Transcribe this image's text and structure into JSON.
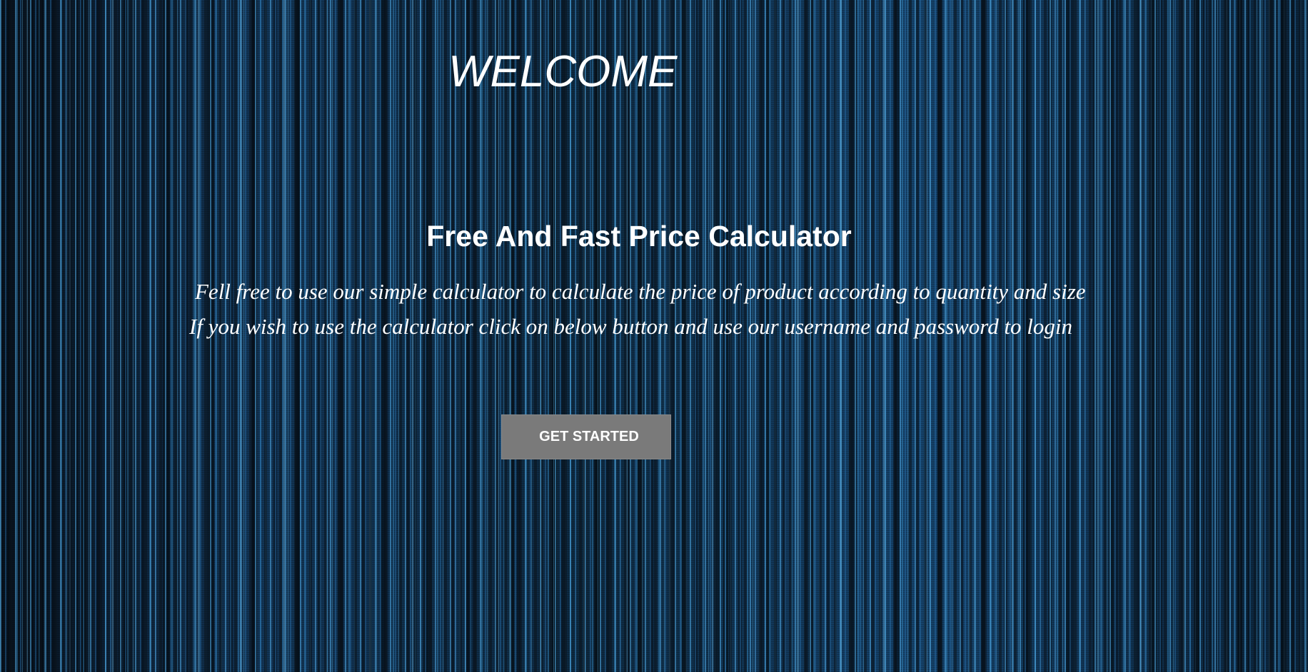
{
  "hero": {
    "welcome": "WELCOME",
    "headline": "Free And Fast Price Calculator",
    "description_line1": "Fell free to use our simple calculator to calculate the price of product according to quantity and size",
    "description_line2": "If you wish to use the calculator click on below button and use our username and password to login"
  },
  "cta": {
    "label": "GET STARTED"
  },
  "colors": {
    "text": "#ffffff",
    "button_bg": "#7a7a7a",
    "background": "#0d2940"
  }
}
